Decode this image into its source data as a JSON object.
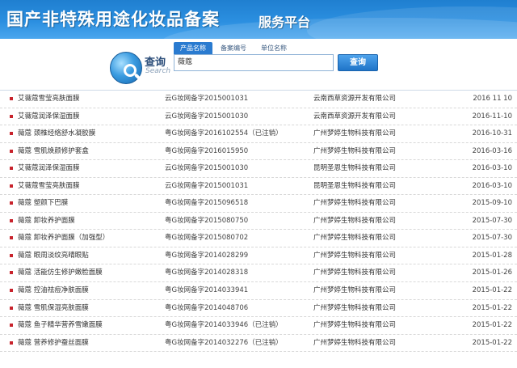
{
  "header": {
    "title": "国产非特殊用途化妆品备案",
    "subtitle": "服务平台"
  },
  "search": {
    "label": "查询",
    "label_en": "Search",
    "tabs": [
      "产品名称",
      "备案编号",
      "单位名称"
    ],
    "active_tab": "产品名称",
    "value": "薇蔻",
    "button_label": "查询"
  },
  "results": [
    {
      "name": "艾薇蔻雪莹亮肤面膜",
      "code": "云G妆网备字2015001031",
      "company": "云南西草资源开发有限公司",
      "date": "2016 11 10"
    },
    {
      "name": "艾薇蔻润泽保湿面膜",
      "code": "云G妆网备字2015001030",
      "company": "云南西草资源开发有限公司",
      "date": "2016-11-10"
    },
    {
      "name": "薇蔻 颈椎经络舒水凝胶膜",
      "code": "粤G妆网备字2016102554（已注销）",
      "company": "广州梦婷生物科技有限公司",
      "date": "2016-10-31"
    },
    {
      "name": "薇蔻 雪肌焕颜修护套盒",
      "code": "粤G妆网备字2016015950",
      "company": "广州梦婷生物科技有限公司",
      "date": "2016-03-16"
    },
    {
      "name": "艾薇蔻润泽保湿面膜",
      "code": "云G妆网备字2015001030",
      "company": "昆明圣恩生物科技有限公司",
      "date": "2016-03-10"
    },
    {
      "name": "艾薇蔻雪莹亮肤面膜",
      "code": "云G妆网备字2015001031",
      "company": "昆明圣恩生物科技有限公司",
      "date": "2016-03-10"
    },
    {
      "name": "薇蔻 塑颜下巴膜",
      "code": "粤G妆网备字2015096518",
      "company": "广州梦婷生物科技有限公司",
      "date": "2015-09-10"
    },
    {
      "name": "薇蔻 卸妆养护面膜",
      "code": "粤G妆网备字2015080750",
      "company": "广州梦婷生物科技有限公司",
      "date": "2015-07-30"
    },
    {
      "name": "薇蔻 卸妆养护面膜（加强型）",
      "code": "粤G妆网备字2015080702",
      "company": "广州梦婷生物科技有限公司",
      "date": "2015-07-30"
    },
    {
      "name": "薇蔻 眼周淡纹亮晴眼贴",
      "code": "粤G妆网备字2014028299",
      "company": "广州梦婷生物科技有限公司",
      "date": "2015-01-28"
    },
    {
      "name": "薇蔻 活能仿生修护嫩脸面膜",
      "code": "粤G妆网备字2014028318",
      "company": "广州梦婷生物科技有限公司",
      "date": "2015-01-26"
    },
    {
      "name": "薇蔻 控油祛痘净肤面膜",
      "code": "粤G妆网备字2014033941",
      "company": "广州梦婷生物科技有限公司",
      "date": "2015-01-22"
    },
    {
      "name": "薇蔻 雪肌保湿亮肤面膜",
      "code": "粤G妆网备字2014048706",
      "company": "广州梦婷生物科技有限公司",
      "date": "2015-01-22"
    },
    {
      "name": "薇蔻 鱼子精华营养雪嫩面膜",
      "code": "粤G妆网备字2014033946（已注销）",
      "company": "广州梦婷生物科技有限公司",
      "date": "2015-01-22"
    },
    {
      "name": "薇蔻 营养修护蚕丝面膜",
      "code": "粤G妆网备字2014032276（已注销）",
      "company": "广州梦婷生物科技有限公司",
      "date": "2015-01-22"
    }
  ]
}
